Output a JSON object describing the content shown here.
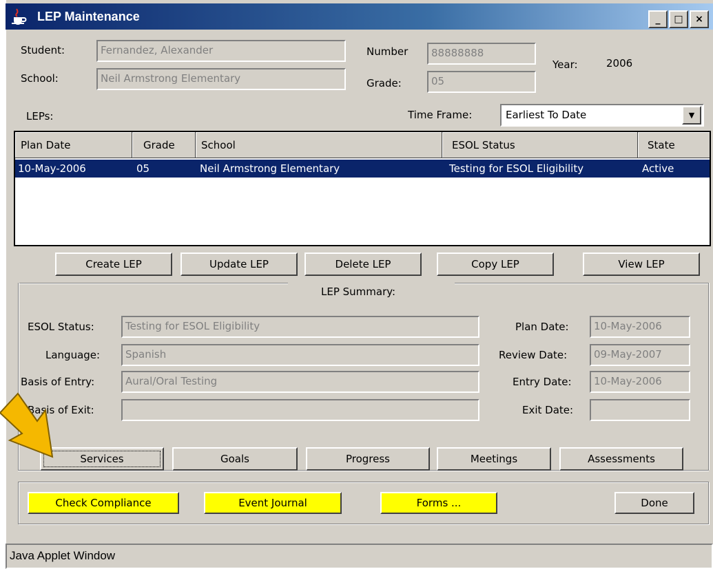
{
  "window": {
    "title": "LEP Maintenance",
    "min": "_",
    "max": "□",
    "close": "×"
  },
  "student": {
    "student_label": "Student:",
    "student_value": "Fernandez, Alexander",
    "school_label": "School:",
    "school_value": "Neil Armstrong Elementary",
    "number_label": "Number",
    "number_value": "88888888",
    "grade_label": "Grade:",
    "grade_value": "05",
    "year_label": "Year:",
    "year_value": "2006"
  },
  "leps_label": "LEPs:",
  "time_frame": {
    "label": "Time Frame:",
    "value": "Earliest To Date",
    "arrow": "▼"
  },
  "table": {
    "columns": [
      "Plan Date",
      "Grade",
      "School",
      "ESOL Status",
      "State"
    ],
    "rows": [
      {
        "plan_date": "10-May-2006",
        "grade": "05",
        "school": "Neil Armstrong Elementary",
        "esol_status": "Testing for ESOL Eligibility",
        "state": "Active"
      }
    ]
  },
  "lep_buttons": {
    "create": "Create LEP",
    "update": "Update LEP",
    "delete": "Delete LEP",
    "copy": "Copy LEP",
    "view": "View LEP"
  },
  "summary": {
    "title": "LEP Summary:",
    "esol_status_label": "ESOL Status:",
    "esol_status_value": "Testing for ESOL Eligibility",
    "language_label": "Language:",
    "language_value": "Spanish",
    "basis_entry_label": "Basis of Entry:",
    "basis_entry_value": "Aural/Oral Testing",
    "basis_exit_label": "Basis of Exit:",
    "basis_exit_value": "",
    "plan_date_label": "Plan Date:",
    "plan_date_value": "10-May-2006",
    "review_date_label": "Review Date:",
    "review_date_value": "09-May-2007",
    "entry_date_label": "Entry Date:",
    "entry_date_value": "10-May-2006",
    "exit_date_label": "Exit Date:",
    "exit_date_value": ""
  },
  "detail_buttons": {
    "services": "Services",
    "goals": "Goals",
    "progress": "Progress",
    "meetings": "Meetings",
    "assessments": "Assessments"
  },
  "bottom_buttons": {
    "check_compliance": "Check Compliance",
    "event_journal": "Event Journal",
    "forms": "Forms ...",
    "done": "Done"
  },
  "status_bar": "Java Applet Window",
  "colors": {
    "selection": "#0a246a",
    "highlight_button": "#ffff00",
    "pointer_arrow": "#f5b800"
  },
  "icons": {
    "app": "java-cup-icon",
    "pointer": "arrow-pointer-icon"
  }
}
